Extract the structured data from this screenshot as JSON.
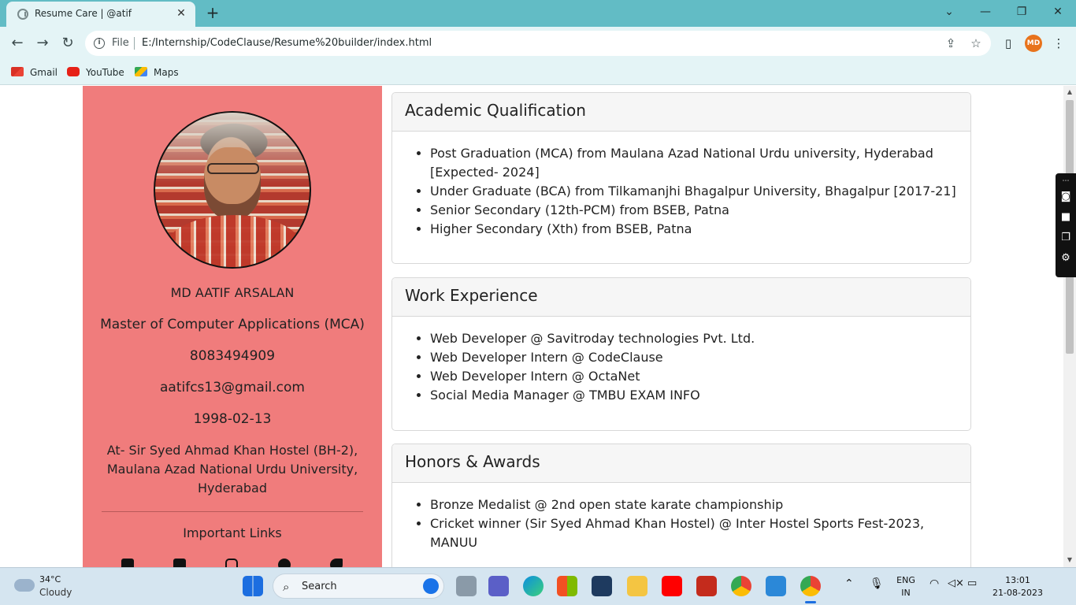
{
  "browser": {
    "tab_title": "Resume Care | @atif",
    "tab_close": "✕",
    "new_tab": "+",
    "file_label": "File",
    "url": "E:/Internship/CodeClause/Resume%20builder/index.html",
    "profile_initials": "MD",
    "bookmarks": [
      {
        "label": "Gmail",
        "icon": "gmail-icon"
      },
      {
        "label": "YouTube",
        "icon": "youtube-icon"
      },
      {
        "label": "Maps",
        "icon": "maps-icon"
      }
    ]
  },
  "profile": {
    "name": "MD AATIF ARSALAN",
    "degree": "Master of Computer Applications (MCA)",
    "phone": "8083494909",
    "email": "aatifcs13@gmail.com",
    "dob": "1998-02-13",
    "address_line1": "At- Sir Syed Ahmad Khan Hostel (BH-2),",
    "address_line2": "Maulana Azad National Urdu University,",
    "address_line3": "Hyderabad",
    "links_heading": "Important Links",
    "social_icons": [
      "github-icon",
      "linkedin-icon",
      "instagram-icon",
      "facebook-icon",
      "twitter-icon"
    ]
  },
  "sections": {
    "academic": {
      "title": "Academic Qualification",
      "items": [
        "Post Graduation (MCA) from Maulana Azad National Urdu university, Hyderabad [Expected- 2024]",
        "Under Graduate (BCA) from Tilkamanjhi Bhagalpur University, Bhagalpur [2017-21]",
        "Senior Secondary (12th-PCM) from BSEB, Patna",
        "Higher Secondary (Xth) from BSEB, Patna"
      ]
    },
    "work": {
      "title": "Work Experience",
      "items": [
        "Web Developer @ Savitroday technologies Pvt. Ltd.",
        "Web Developer Intern @ CodeClause",
        "Web Developer Intern @ OctaNet",
        "Social Media Manager @ TMBU EXAM INFO"
      ]
    },
    "honors": {
      "title": "Honors & Awards",
      "items": [
        "Bronze Medalist @ 2nd open state karate championship",
        "Cricket winner (Sir Syed Ahmad Khan Hostel) @ Inter Hostel Sports Fest-2023, MANUU"
      ]
    }
  },
  "taskbar": {
    "temperature": "34°C",
    "weather": "Cloudy",
    "search_label": "Search",
    "language_line1": "ENG",
    "language_line2": "IN",
    "time": "13:01",
    "date": "21-08-2023"
  },
  "colors": {
    "sidebar": "#f07c7c",
    "tabbar": "#62bcc5",
    "toolbar": "#e4f4f6"
  }
}
